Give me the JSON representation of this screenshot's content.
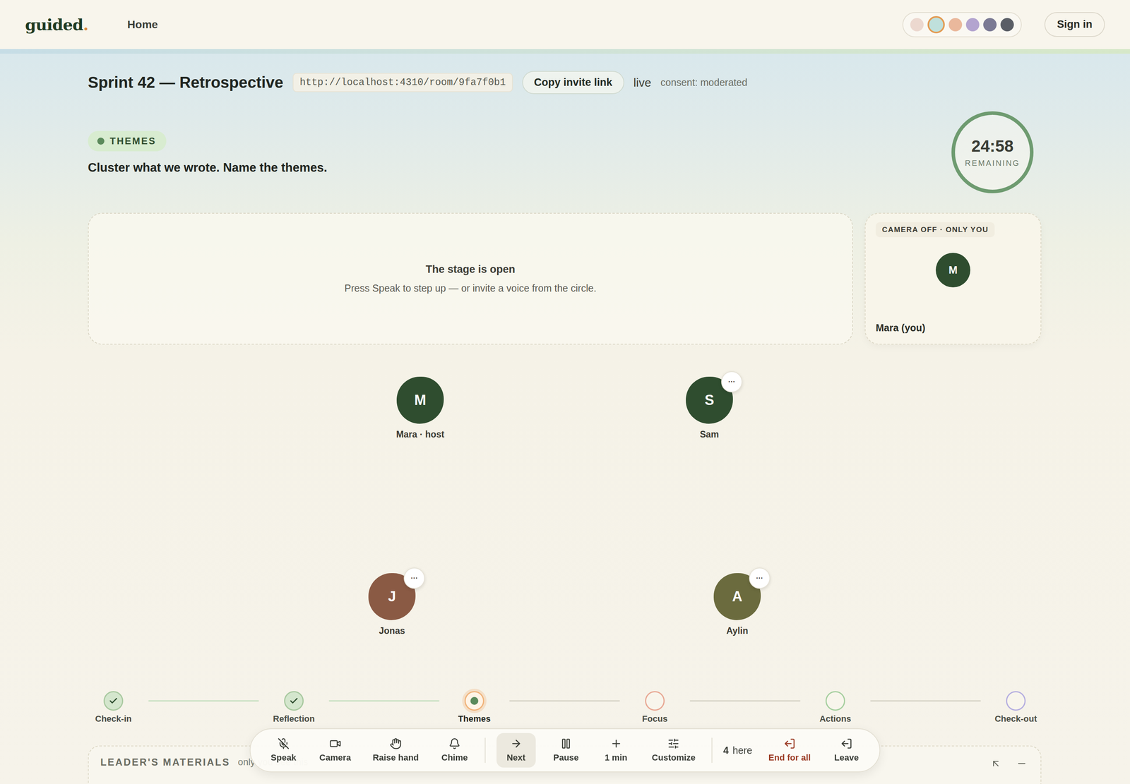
{
  "header": {
    "logo": {
      "text": "guided",
      "mark": "."
    },
    "nav": [
      {
        "label": "Home",
        "selected": true
      }
    ],
    "swatches": [
      {
        "color": "#ecd8cf",
        "selected": false
      },
      {
        "color": "#bfe0dc",
        "selected": true
      },
      {
        "color": "#eab89c",
        "selected": false
      },
      {
        "color": "#b3a4cf",
        "selected": false
      },
      {
        "color": "#7b7a94",
        "selected": false
      },
      {
        "color": "#5a5e66",
        "selected": false
      }
    ],
    "signIn": "Sign in"
  },
  "room": {
    "title": "Sprint 42 — Retrospective",
    "url": "http://localhost:4310/room/9fa7f0b1",
    "copyButton": "Copy invite link",
    "status": "live",
    "consent": "consent: moderated"
  },
  "phase": {
    "badge": "THEMES",
    "prompt": "Cluster what we wrote. Name the themes."
  },
  "timer": {
    "time": "24:58",
    "label": "REMAINING",
    "level": 0.999
  },
  "stage": {
    "title": "The stage is open",
    "hint": "Press Speak to step up — or invite a voice from the circle."
  },
  "selfView": {
    "badge": "CAMERA OFF · ONLY YOU",
    "initial": "M",
    "name": "Mara (you)"
  },
  "menuGlyph": "···",
  "participants": [
    {
      "initial": "M",
      "name": "Mara · host",
      "color": "#2f4d2f",
      "hasMenu": false
    },
    {
      "initial": "S",
      "name": "Sam",
      "color": "#2f4d2f",
      "hasMenu": true
    },
    {
      "initial": "J",
      "name": "Jonas",
      "color": "#8a5a44",
      "hasMenu": true
    },
    {
      "initial": "A",
      "name": "Aylin",
      "color": "#6b6b3e",
      "hasMenu": true
    }
  ],
  "steps": [
    {
      "label": "Check-in",
      "kind": "done",
      "color": "#a9c9a0"
    },
    {
      "label": "Reflection",
      "kind": "done",
      "color": "#a9c9a0"
    },
    {
      "label": "Themes",
      "kind": "current",
      "color": "#f0b37a"
    },
    {
      "label": "Focus",
      "kind": "upcoming",
      "color": "#e8a894"
    },
    {
      "label": "Actions",
      "kind": "upcoming",
      "color": "#a6cf9f"
    },
    {
      "label": "Check-out",
      "kind": "upcoming",
      "color": "#b5aee0"
    }
  ],
  "toolbar": {
    "controls": [
      {
        "label": "Speak",
        "selected": false
      },
      {
        "label": "Camera",
        "selected": false
      },
      {
        "label": "Raise hand",
        "selected": false
      },
      {
        "label": "Chime",
        "selected": false
      }
    ],
    "flow": [
      {
        "label": "Next",
        "selected": true
      },
      {
        "label": "Pause",
        "selected": false
      },
      {
        "label": "1 min",
        "selected": false
      },
      {
        "label": "Customize",
        "selected": false
      }
    ],
    "presence": {
      "count": "4",
      "label": "here"
    },
    "exits": [
      {
        "label": "End for all",
        "danger": true
      },
      {
        "label": "Leave",
        "danger": false
      }
    ]
  },
  "materials": {
    "title": "LEADER'S MATERIALS",
    "note": "only you see this"
  }
}
